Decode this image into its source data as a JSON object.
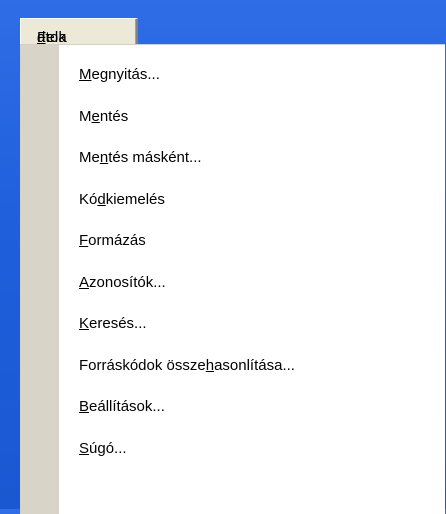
{
  "menu": {
    "title": {
      "pre": "Fela",
      "key": "d",
      "post": "atok"
    },
    "items": [
      {
        "pre": "",
        "key": "M",
        "post": "egnyitás..."
      },
      {
        "pre": "M",
        "key": "e",
        "post": "ntés"
      },
      {
        "pre": "Me",
        "key": "n",
        "post": "tés másként..."
      },
      {
        "pre": "Kó",
        "key": "d",
        "post": "kiemelés"
      },
      {
        "pre": "",
        "key": "F",
        "post": "ormázás"
      },
      {
        "pre": "",
        "key": "A",
        "post": "zonosítók..."
      },
      {
        "pre": "",
        "key": "K",
        "post": "eresés..."
      },
      {
        "pre": "Forráskódok össze",
        "key": "h",
        "post": "asonlítása..."
      },
      {
        "pre": "",
        "key": "B",
        "post": "eállítások..."
      },
      {
        "pre": "",
        "key": "S",
        "post": "úgó..."
      }
    ]
  }
}
